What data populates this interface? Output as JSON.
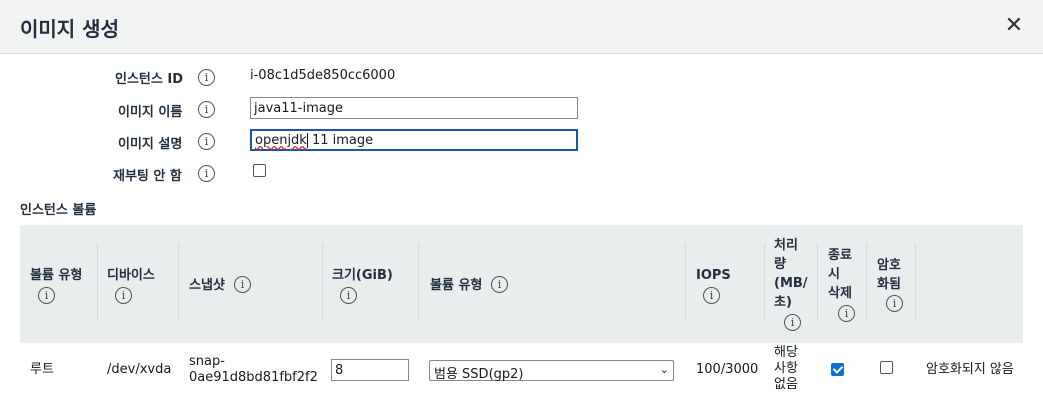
{
  "dialog": {
    "title": "이미지 생성"
  },
  "form": {
    "instance_id_label": "인스턴스 ID",
    "instance_id_value": "i-08c1d5de850cc6000",
    "image_name_label": "이미지 이름",
    "image_name_value": "java11-image",
    "image_desc_label": "이미지 설명",
    "image_desc_value_a": "openjdk",
    "image_desc_value_b": " 11 image",
    "no_reboot_label": "재부팅 안 함",
    "no_reboot_checked": false
  },
  "volumes": {
    "section_title": "인스턴스 볼륨",
    "headers": {
      "volume_type": "볼륨 유형",
      "device": "디바이스",
      "snapshot": "스냅샷",
      "size": "크기(GiB)",
      "volume_type2": "볼륨 유형",
      "iops": "IOPS",
      "throughput_1": "처리",
      "throughput_2": "량",
      "throughput_3": "(MB/",
      "throughput_4": "초)",
      "delete_1": "종료",
      "delete_2": "시",
      "delete_3": "삭제",
      "encrypt_1": "암호",
      "encrypt_2": "화됨"
    },
    "row": {
      "volume_type": "루트",
      "device": "/dev/xvda",
      "snapshot_1": "snap-",
      "snapshot_2": "0ae91d8bd81fbf2f2",
      "size": "8",
      "type_select": "범용 SSD(gp2)",
      "iops": "100/3000",
      "throughput_1": "해당",
      "throughput_2": "사항",
      "throughput_3": "없음",
      "delete_on_termination": true,
      "encrypted_checked": false,
      "encrypted_text": "암호화되지 않음"
    }
  },
  "icons": {
    "info": "i",
    "close": "✕",
    "dropdown": "⌄"
  }
}
